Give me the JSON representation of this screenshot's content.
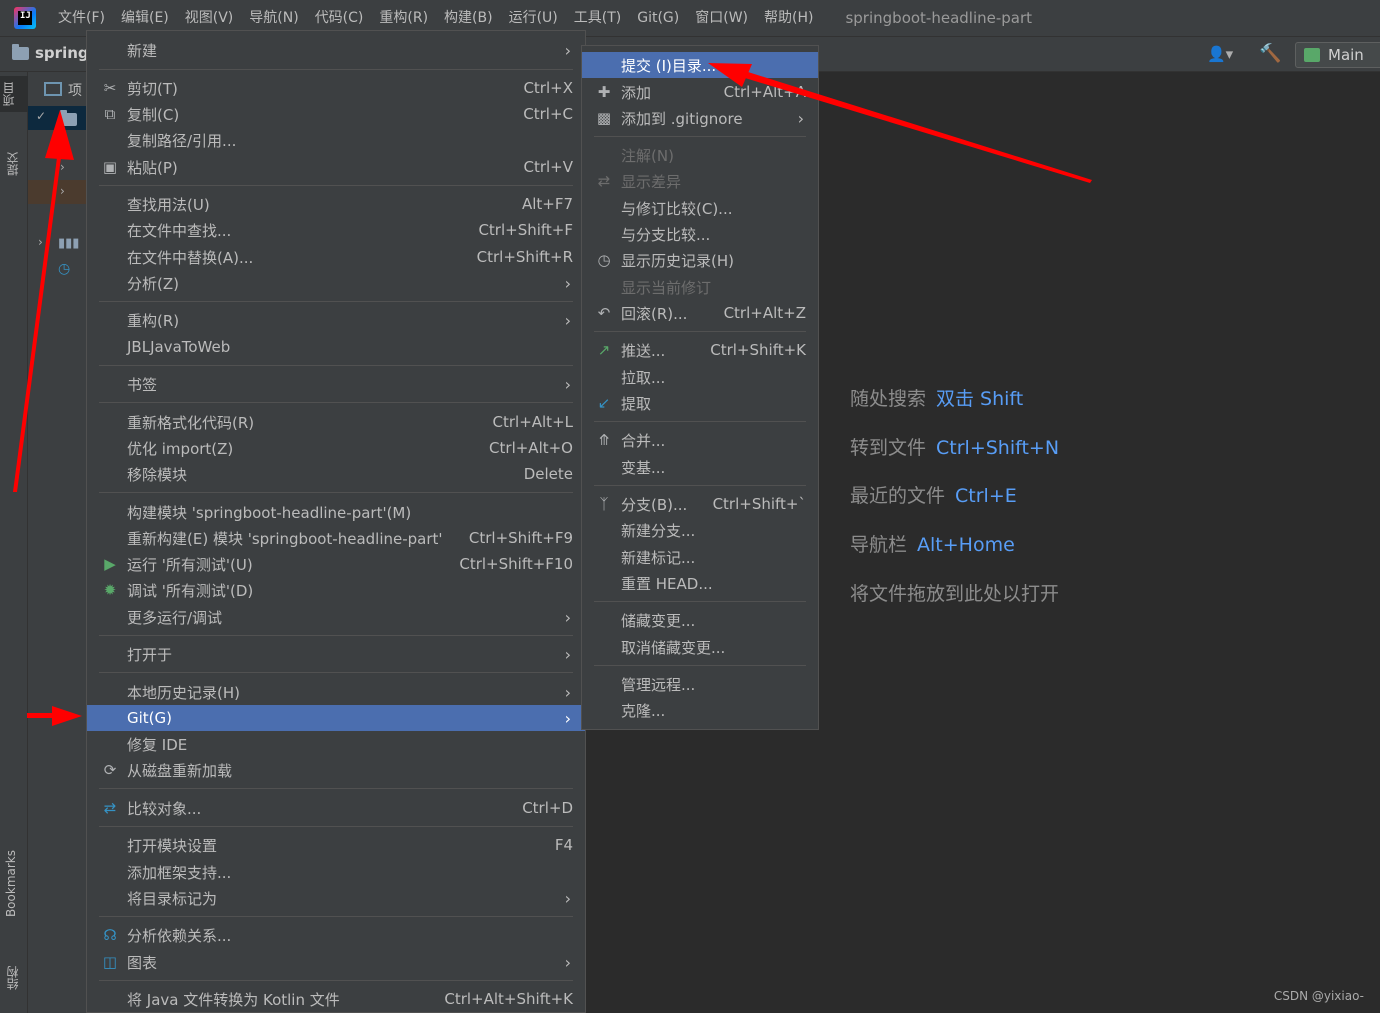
{
  "menubar": {
    "items": [
      "文件(F)",
      "编辑(E)",
      "视图(V)",
      "导航(N)",
      "代码(C)",
      "重构(R)",
      "构建(B)",
      "运行(U)",
      "工具(T)",
      "Git(G)",
      "窗口(W)",
      "帮助(H)"
    ],
    "title": "springboot-headline-part"
  },
  "toolbar": {
    "project_name": "springl",
    "run_config": "Main"
  },
  "left_strip": {
    "tabs": [
      "项目",
      "提交",
      "Bookmarks",
      "结构"
    ]
  },
  "project_panel": {
    "header_label": "项"
  },
  "context_menu": {
    "items": [
      {
        "label": "新建",
        "shortcut": "",
        "submenu": true,
        "icon": ""
      },
      {
        "label": "剪切(T)",
        "shortcut": "Ctrl+X",
        "icon": "scissors-icon"
      },
      {
        "label": "复制(C)",
        "shortcut": "Ctrl+C",
        "icon": "copy-icon"
      },
      {
        "label": "复制路径/引用...",
        "shortcut": "",
        "icon": ""
      },
      {
        "label": "粘贴(P)",
        "shortcut": "Ctrl+V",
        "icon": "paste-icon"
      },
      {
        "label": "查找用法(U)",
        "shortcut": "Alt+F7",
        "icon": ""
      },
      {
        "label": "在文件中查找...",
        "shortcut": "Ctrl+Shift+F",
        "icon": ""
      },
      {
        "label": "在文件中替换(A)...",
        "shortcut": "Ctrl+Shift+R",
        "icon": ""
      },
      {
        "label": "分析(Z)",
        "shortcut": "",
        "submenu": true,
        "icon": ""
      },
      {
        "label": "重构(R)",
        "shortcut": "",
        "submenu": true,
        "icon": ""
      },
      {
        "label": "JBLJavaToWeb",
        "shortcut": "",
        "icon": ""
      },
      {
        "label": "书签",
        "shortcut": "",
        "submenu": true,
        "icon": ""
      },
      {
        "label": "重新格式化代码(R)",
        "shortcut": "Ctrl+Alt+L",
        "icon": ""
      },
      {
        "label": "优化 import(Z)",
        "shortcut": "Ctrl+Alt+O",
        "icon": ""
      },
      {
        "label": "移除模块",
        "shortcut": "Delete",
        "icon": ""
      },
      {
        "label": "构建模块 'springboot-headline-part'(M)",
        "shortcut": "",
        "icon": ""
      },
      {
        "label": "重新构建(E) 模块 'springboot-headline-part'",
        "shortcut": "Ctrl+Shift+F9",
        "icon": ""
      },
      {
        "label": "运行 '所有测试'(U)",
        "shortcut": "Ctrl+Shift+F10",
        "icon": "run-icon"
      },
      {
        "label": "调试 '所有测试'(D)",
        "shortcut": "",
        "icon": "debug-icon"
      },
      {
        "label": "更多运行/调试",
        "shortcut": "",
        "submenu": true,
        "icon": ""
      },
      {
        "label": "打开于",
        "shortcut": "",
        "submenu": true,
        "icon": ""
      },
      {
        "label": "本地历史记录(H)",
        "shortcut": "",
        "submenu": true,
        "icon": ""
      },
      {
        "label": "Git(G)",
        "shortcut": "",
        "submenu": true,
        "icon": "",
        "active": true
      },
      {
        "label": "修复 IDE",
        "shortcut": "",
        "icon": ""
      },
      {
        "label": "从磁盘重新加载",
        "shortcut": "",
        "icon": "reload-icon"
      },
      {
        "label": "比较对象...",
        "shortcut": "Ctrl+D",
        "icon": "compare-icon"
      },
      {
        "label": "打开模块设置",
        "shortcut": "F4",
        "icon": ""
      },
      {
        "label": "添加框架支持...",
        "shortcut": "",
        "icon": ""
      },
      {
        "label": "将目录标记为",
        "shortcut": "",
        "submenu": true,
        "icon": ""
      },
      {
        "label": "分析依赖关系...",
        "shortcut": "",
        "icon": "dependency-icon"
      },
      {
        "label": "图表",
        "shortcut": "",
        "submenu": true,
        "icon": "diagram-icon"
      },
      {
        "label": "将 Java 文件转换为 Kotlin 文件",
        "shortcut": "Ctrl+Alt+Shift+K",
        "icon": ""
      }
    ]
  },
  "git_menu": {
    "items": [
      {
        "label": "提交 (I)目录...",
        "shortcut": "",
        "icon": "",
        "active": true
      },
      {
        "label": "添加",
        "shortcut": "Ctrl+Alt+A",
        "icon": "plus-icon"
      },
      {
        "label": "添加到 .gitignore",
        "shortcut": "",
        "submenu": true,
        "icon": "gitignore-icon"
      },
      {
        "label": "注解(N)",
        "shortcut": "",
        "icon": "",
        "disabled": true
      },
      {
        "label": "显示差异",
        "shortcut": "",
        "icon": "diff-icon",
        "disabled": true
      },
      {
        "label": "与修订比较(C)...",
        "shortcut": "",
        "icon": ""
      },
      {
        "label": "与分支比较...",
        "shortcut": "",
        "icon": ""
      },
      {
        "label": "显示历史记录(H)",
        "shortcut": "",
        "icon": "history-icon"
      },
      {
        "label": "显示当前修订",
        "shortcut": "",
        "icon": "",
        "disabled": true
      },
      {
        "label": "回滚(R)...",
        "shortcut": "Ctrl+Alt+Z",
        "icon": "rollback-icon"
      },
      {
        "label": "推送...",
        "shortcut": "Ctrl+Shift+K",
        "icon": "push-icon"
      },
      {
        "label": "拉取...",
        "shortcut": "",
        "icon": ""
      },
      {
        "label": "提取",
        "shortcut": "",
        "icon": "fetch-icon"
      },
      {
        "label": "合并...",
        "shortcut": "",
        "icon": "merge-icon"
      },
      {
        "label": "变基...",
        "shortcut": "",
        "icon": ""
      },
      {
        "label": "分支(B)...",
        "shortcut": "Ctrl+Shift+`",
        "icon": "branch-icon"
      },
      {
        "label": "新建分支...",
        "shortcut": "",
        "icon": ""
      },
      {
        "label": "新建标记...",
        "shortcut": "",
        "icon": ""
      },
      {
        "label": "重置 HEAD...",
        "shortcut": "",
        "icon": ""
      },
      {
        "label": "储藏变更...",
        "shortcut": "",
        "icon": ""
      },
      {
        "label": "取消储藏变更...",
        "shortcut": "",
        "icon": ""
      },
      {
        "label": "管理远程...",
        "shortcut": "",
        "icon": ""
      },
      {
        "label": "克隆...",
        "shortcut": "",
        "icon": ""
      }
    ]
  },
  "editor_hints": [
    {
      "text": "随处搜索",
      "key": "双击 Shift"
    },
    {
      "text": "转到文件",
      "key": "Ctrl+Shift+N"
    },
    {
      "text": "最近的文件",
      "key": "Ctrl+E"
    },
    {
      "text": "导航栏",
      "key": "Alt+Home"
    },
    {
      "text": "将文件拖放到此处以打开",
      "key": ""
    }
  ],
  "watermark": "CSDN @yixiao-",
  "colors": {
    "menu_bg": "#3c3f41",
    "selection": "#4b6eaf",
    "editor_bg": "#2b2b2b",
    "hint_key": "#589df6",
    "annotation_arrow": "#ff0000"
  }
}
